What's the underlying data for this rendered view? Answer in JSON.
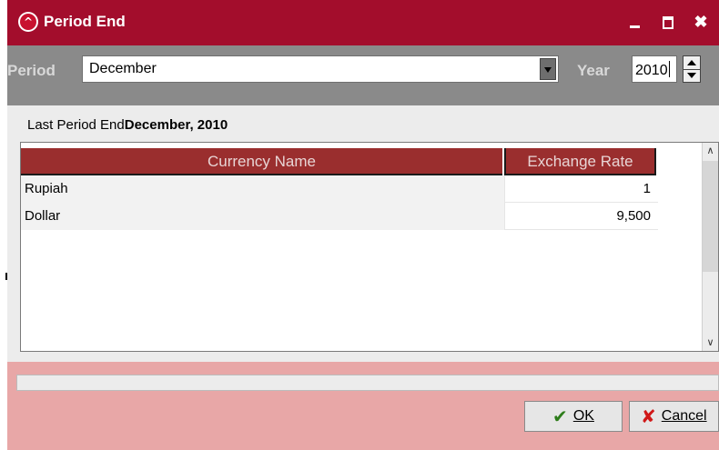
{
  "window": {
    "title": "Period End",
    "app_icon": "caret-logo-icon",
    "controls": [
      "minimize-icon",
      "maximize-icon",
      "close-icon"
    ],
    "close_glyph": "✖"
  },
  "filter": {
    "period_label": "Period",
    "period_value": "December",
    "year_label": "Year",
    "year_value": "2010"
  },
  "status": {
    "last_label": "Last Period End",
    "last_value": "December, 2010"
  },
  "table": {
    "columns": [
      "Currency Name",
      "Exchange Rate"
    ],
    "rows": [
      {
        "name": "Rupiah",
        "rate": "1"
      },
      {
        "name": "Dollar",
        "rate": "9,500"
      }
    ]
  },
  "buttons": {
    "ok_label": "OK",
    "cancel_label": "Cancel"
  },
  "colors": {
    "titlebar": "#a30d2c",
    "header": "#9a2e2e",
    "footer": "#e8a7a7"
  }
}
